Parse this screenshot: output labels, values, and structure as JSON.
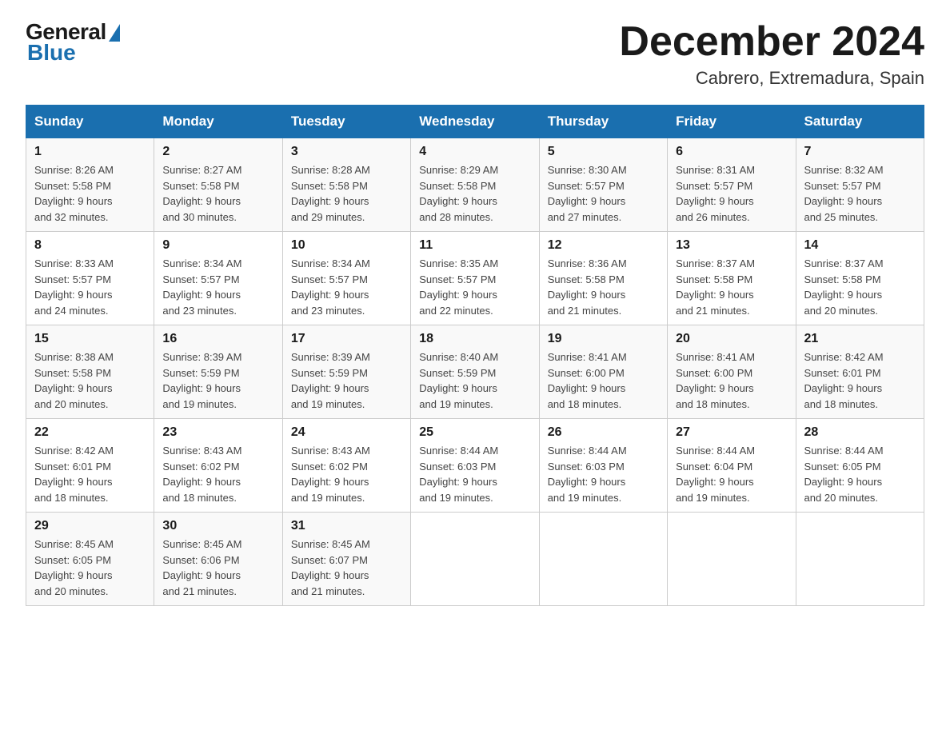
{
  "logo": {
    "general": "General",
    "blue": "Blue"
  },
  "title": "December 2024",
  "location": "Cabrero, Extremadura, Spain",
  "days_of_week": [
    "Sunday",
    "Monday",
    "Tuesday",
    "Wednesday",
    "Thursday",
    "Friday",
    "Saturday"
  ],
  "weeks": [
    [
      {
        "day": "1",
        "sunrise": "8:26 AM",
        "sunset": "5:58 PM",
        "daylight": "9 hours and 32 minutes."
      },
      {
        "day": "2",
        "sunrise": "8:27 AM",
        "sunset": "5:58 PM",
        "daylight": "9 hours and 30 minutes."
      },
      {
        "day": "3",
        "sunrise": "8:28 AM",
        "sunset": "5:58 PM",
        "daylight": "9 hours and 29 minutes."
      },
      {
        "day": "4",
        "sunrise": "8:29 AM",
        "sunset": "5:58 PM",
        "daylight": "9 hours and 28 minutes."
      },
      {
        "day": "5",
        "sunrise": "8:30 AM",
        "sunset": "5:57 PM",
        "daylight": "9 hours and 27 minutes."
      },
      {
        "day": "6",
        "sunrise": "8:31 AM",
        "sunset": "5:57 PM",
        "daylight": "9 hours and 26 minutes."
      },
      {
        "day": "7",
        "sunrise": "8:32 AM",
        "sunset": "5:57 PM",
        "daylight": "9 hours and 25 minutes."
      }
    ],
    [
      {
        "day": "8",
        "sunrise": "8:33 AM",
        "sunset": "5:57 PM",
        "daylight": "9 hours and 24 minutes."
      },
      {
        "day": "9",
        "sunrise": "8:34 AM",
        "sunset": "5:57 PM",
        "daylight": "9 hours and 23 minutes."
      },
      {
        "day": "10",
        "sunrise": "8:34 AM",
        "sunset": "5:57 PM",
        "daylight": "9 hours and 23 minutes."
      },
      {
        "day": "11",
        "sunrise": "8:35 AM",
        "sunset": "5:57 PM",
        "daylight": "9 hours and 22 minutes."
      },
      {
        "day": "12",
        "sunrise": "8:36 AM",
        "sunset": "5:58 PM",
        "daylight": "9 hours and 21 minutes."
      },
      {
        "day": "13",
        "sunrise": "8:37 AM",
        "sunset": "5:58 PM",
        "daylight": "9 hours and 21 minutes."
      },
      {
        "day": "14",
        "sunrise": "8:37 AM",
        "sunset": "5:58 PM",
        "daylight": "9 hours and 20 minutes."
      }
    ],
    [
      {
        "day": "15",
        "sunrise": "8:38 AM",
        "sunset": "5:58 PM",
        "daylight": "9 hours and 20 minutes."
      },
      {
        "day": "16",
        "sunrise": "8:39 AM",
        "sunset": "5:59 PM",
        "daylight": "9 hours and 19 minutes."
      },
      {
        "day": "17",
        "sunrise": "8:39 AM",
        "sunset": "5:59 PM",
        "daylight": "9 hours and 19 minutes."
      },
      {
        "day": "18",
        "sunrise": "8:40 AM",
        "sunset": "5:59 PM",
        "daylight": "9 hours and 19 minutes."
      },
      {
        "day": "19",
        "sunrise": "8:41 AM",
        "sunset": "6:00 PM",
        "daylight": "9 hours and 18 minutes."
      },
      {
        "day": "20",
        "sunrise": "8:41 AM",
        "sunset": "6:00 PM",
        "daylight": "9 hours and 18 minutes."
      },
      {
        "day": "21",
        "sunrise": "8:42 AM",
        "sunset": "6:01 PM",
        "daylight": "9 hours and 18 minutes."
      }
    ],
    [
      {
        "day": "22",
        "sunrise": "8:42 AM",
        "sunset": "6:01 PM",
        "daylight": "9 hours and 18 minutes."
      },
      {
        "day": "23",
        "sunrise": "8:43 AM",
        "sunset": "6:02 PM",
        "daylight": "9 hours and 18 minutes."
      },
      {
        "day": "24",
        "sunrise": "8:43 AM",
        "sunset": "6:02 PM",
        "daylight": "9 hours and 19 minutes."
      },
      {
        "day": "25",
        "sunrise": "8:44 AM",
        "sunset": "6:03 PM",
        "daylight": "9 hours and 19 minutes."
      },
      {
        "day": "26",
        "sunrise": "8:44 AM",
        "sunset": "6:03 PM",
        "daylight": "9 hours and 19 minutes."
      },
      {
        "day": "27",
        "sunrise": "8:44 AM",
        "sunset": "6:04 PM",
        "daylight": "9 hours and 19 minutes."
      },
      {
        "day": "28",
        "sunrise": "8:44 AM",
        "sunset": "6:05 PM",
        "daylight": "9 hours and 20 minutes."
      }
    ],
    [
      {
        "day": "29",
        "sunrise": "8:45 AM",
        "sunset": "6:05 PM",
        "daylight": "9 hours and 20 minutes."
      },
      {
        "day": "30",
        "sunrise": "8:45 AM",
        "sunset": "6:06 PM",
        "daylight": "9 hours and 21 minutes."
      },
      {
        "day": "31",
        "sunrise": "8:45 AM",
        "sunset": "6:07 PM",
        "daylight": "9 hours and 21 minutes."
      },
      null,
      null,
      null,
      null
    ]
  ],
  "labels": {
    "sunrise": "Sunrise:",
    "sunset": "Sunset:",
    "daylight": "Daylight:"
  }
}
